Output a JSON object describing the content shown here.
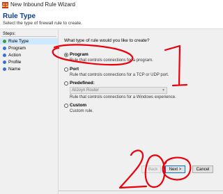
{
  "window": {
    "title": "New Inbound Rule Wizard",
    "icon": "firewall-icon"
  },
  "header": {
    "title": "Rule Type",
    "description": "Select the type of firewall rule to create."
  },
  "sidebar": {
    "heading": "Steps:",
    "steps": [
      {
        "label": "Rule Type",
        "status": "done"
      },
      {
        "label": "Program",
        "status": "pending"
      },
      {
        "label": "Action",
        "status": "pending"
      },
      {
        "label": "Profile",
        "status": "pending"
      },
      {
        "label": "Name",
        "status": "pending"
      }
    ]
  },
  "main": {
    "question": "What type of rule would you like to create?",
    "options": [
      {
        "label": "Program",
        "description": "Rule that controls connections for a program.",
        "selected": true
      },
      {
        "label": "Port",
        "description": "Rule that controls connections for a TCP or UDP port.",
        "selected": false
      },
      {
        "label": "Predefined:",
        "description": "Rule that controls connections for a Windows experience.",
        "selected": false
      },
      {
        "label": "Custom",
        "description": "Custom rule.",
        "selected": false
      }
    ],
    "predefined_select": {
      "value": "AllJoyn Router"
    }
  },
  "footer": {
    "back_label": "< Back",
    "next_label": "Next >",
    "cancel_label": "Cancel"
  },
  "annotations": {
    "color": "#e8000b",
    "mark_1": "1",
    "mark_2": "2"
  }
}
